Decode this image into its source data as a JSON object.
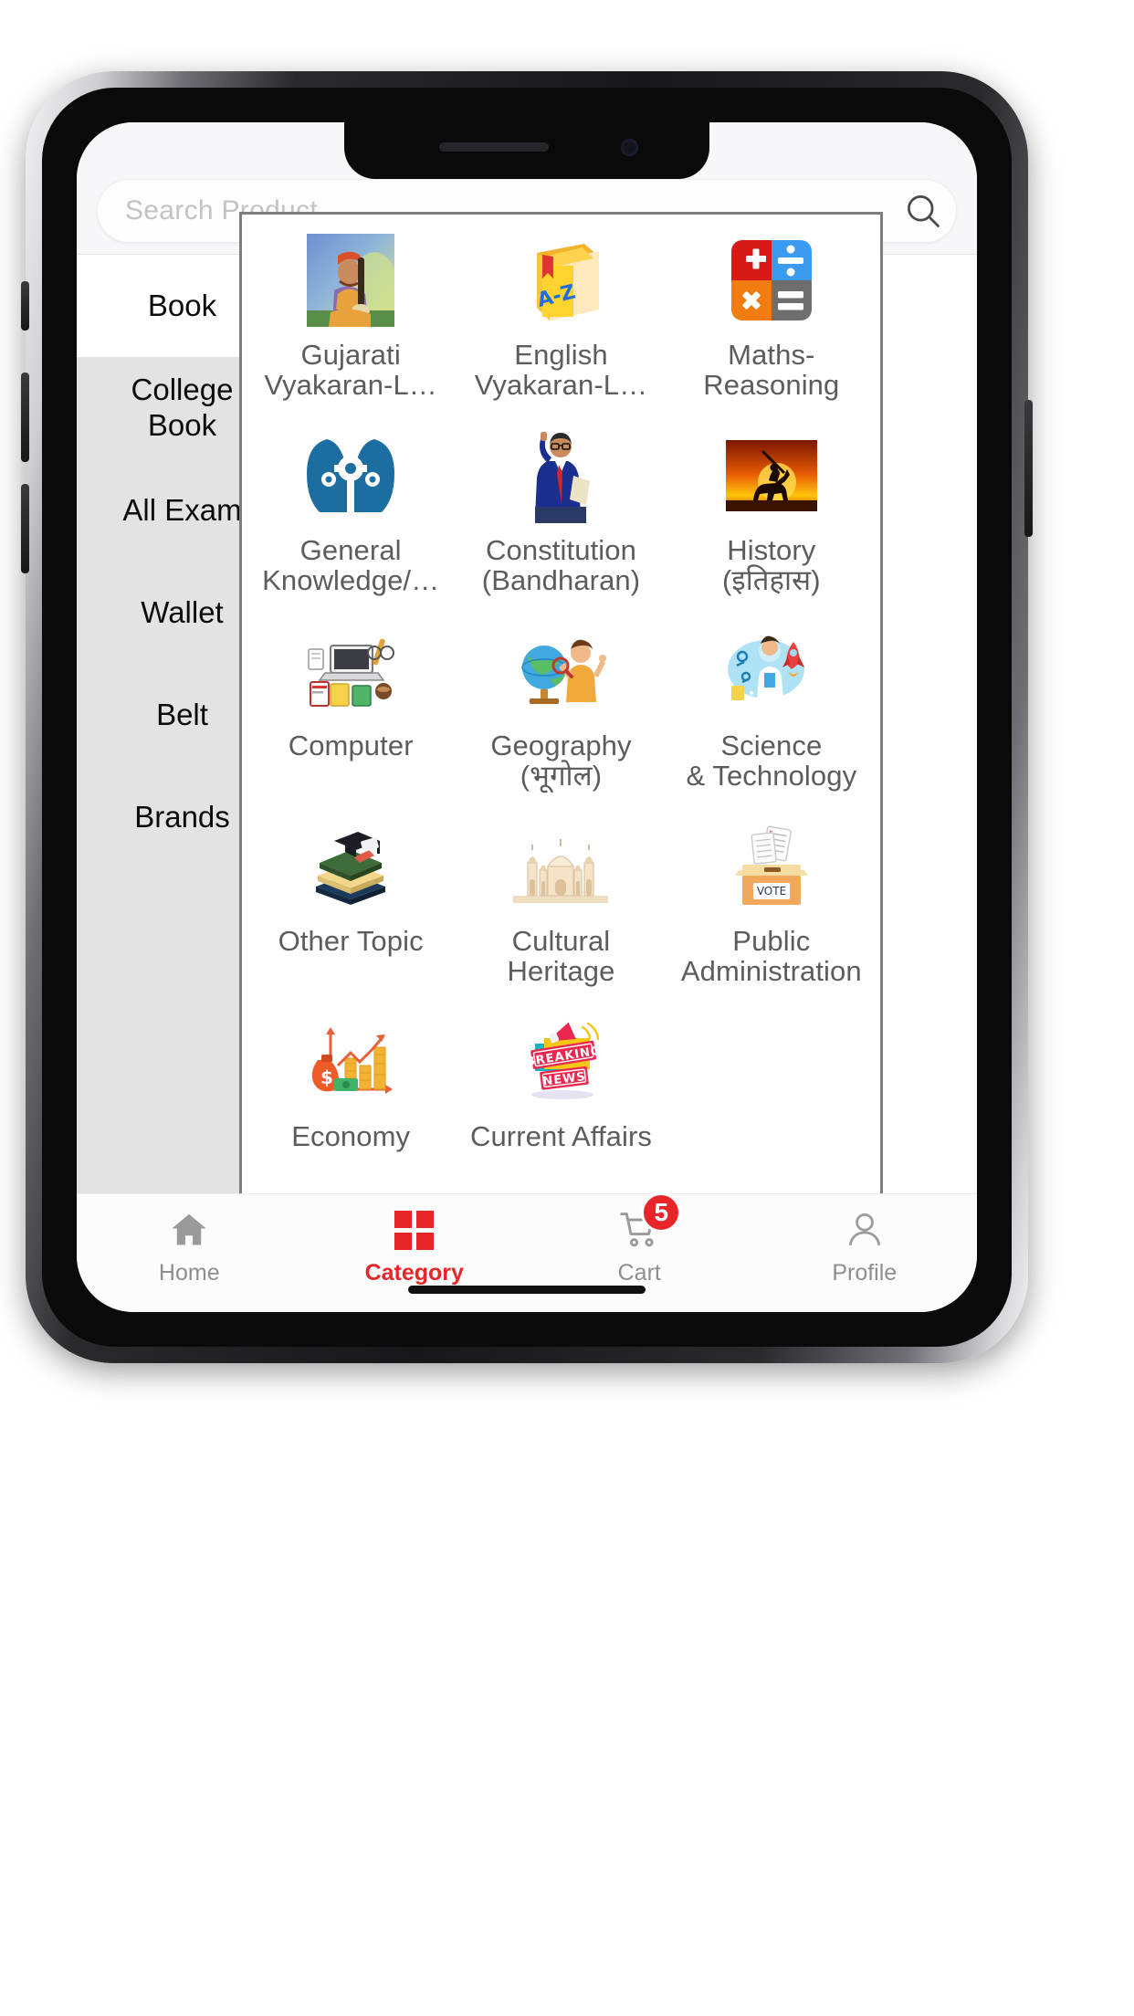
{
  "search": {
    "placeholder": "Search Product",
    "value": "",
    "icon": "search-icon"
  },
  "sidebar": {
    "items": [
      {
        "label": "Book",
        "active": true
      },
      {
        "label": "College\nBook",
        "active": false
      },
      {
        "label": "All Exam",
        "active": false
      },
      {
        "label": "Wallet",
        "active": false
      },
      {
        "label": "Belt",
        "active": false
      },
      {
        "label": "Brands",
        "active": false
      }
    ]
  },
  "categories": [
    {
      "label": "Gujarati\nVyakaran-L…",
      "icon": "saint-portrait-icon"
    },
    {
      "label": "English\nVyakaran-L…",
      "icon": "az-book-icon"
    },
    {
      "label": "Maths-\nReasoning",
      "icon": "calculator-keys-icon"
    },
    {
      "label": "General\nKnowledge/…",
      "icon": "heads-gears-icon"
    },
    {
      "label": "Constitution\n(Bandharan)",
      "icon": "ambedkar-icon"
    },
    {
      "label": "History\n(इतिहास)",
      "icon": "horse-rider-sunset-icon"
    },
    {
      "label": "Computer",
      "icon": "laptop-desk-icon"
    },
    {
      "label": "Geography\n(भूगोल)",
      "icon": "globe-student-icon"
    },
    {
      "label": "Science\n& Technology",
      "icon": "science-rocket-icon"
    },
    {
      "label": "Other Topic",
      "icon": "books-graduation-icon"
    },
    {
      "label": "Cultural\nHeritage",
      "icon": "taj-mahal-icon"
    },
    {
      "label": "Public\nAdministration",
      "icon": "vote-ballot-icon"
    },
    {
      "label": "Economy",
      "icon": "money-growth-chart-icon"
    },
    {
      "label": "Current Affairs",
      "icon": "breaking-news-icon"
    }
  ],
  "bottom_nav": {
    "items": [
      {
        "label": "Home",
        "icon": "home-icon",
        "active": false,
        "badge": ""
      },
      {
        "label": "Category",
        "icon": "grid-icon",
        "active": true,
        "badge": ""
      },
      {
        "label": "Cart",
        "icon": "cart-icon",
        "active": false,
        "badge": "5"
      },
      {
        "label": "Profile",
        "icon": "person-icon",
        "active": false,
        "badge": ""
      }
    ]
  },
  "colors": {
    "accent": "#e8262a",
    "sidebar_bg": "#e3e3e3",
    "label_text": "#5c5c5c",
    "inactive_nav": "#8e8e8e"
  },
  "icon_text": {
    "az_book": "A-Z",
    "vote_box": "VOTE",
    "breaking": "BREAKING",
    "news": "NEWS"
  }
}
